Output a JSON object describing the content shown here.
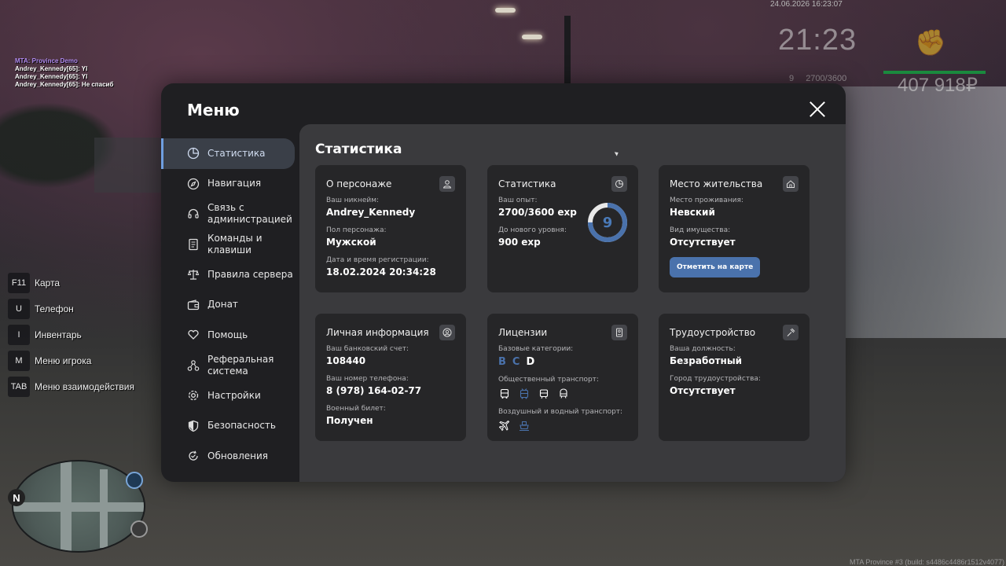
{
  "chat": {
    "server": "MTA: Province Demo",
    "messages": [
      "Andrey_Kennedy[65]: Yl",
      "Andrey_Kennedy[65]: Yl",
      "Andrey_Kennedy[65]: Не спасиб"
    ]
  },
  "hud": {
    "datetime": "24.06.2026 16:23:07",
    "time": "21:23",
    "level": "9",
    "exp": "2700/3600",
    "money": "407 918₽",
    "health_color": "#1a8a3e"
  },
  "hotkeys": [
    {
      "key": "F11",
      "label": "Карта"
    },
    {
      "key": "U",
      "label": "Телефон"
    },
    {
      "key": "I",
      "label": "Инвентарь"
    },
    {
      "key": "M",
      "label": "Меню игрока"
    },
    {
      "key": "TAB",
      "label": "Меню взаимодействия"
    }
  ],
  "minimap": {
    "north": "N"
  },
  "build": "MTA Province #3 (build: s4486c4486r1512v4077)",
  "menu": {
    "title": "Меню",
    "nav": [
      {
        "label": "Статистика",
        "icon": "pie-chart-icon",
        "active": true
      },
      {
        "label": "Навигация",
        "icon": "compass-icon"
      },
      {
        "label": "Связь с администрацией",
        "icon": "headset-icon"
      },
      {
        "label": "Команды и клавиши",
        "icon": "document-icon"
      },
      {
        "label": "Правила сервера",
        "icon": "scales-icon"
      },
      {
        "label": "Донат",
        "icon": "wallet-icon"
      },
      {
        "label": "Помощь",
        "icon": "heart-hand-icon"
      },
      {
        "label": "Реферальная система",
        "icon": "network-icon"
      },
      {
        "label": "Настройки",
        "icon": "gear-icon"
      },
      {
        "label": "Безопасность",
        "icon": "shield-icon"
      },
      {
        "label": "Обновления",
        "icon": "refresh-check-icon"
      }
    ],
    "content_title": "Статистика",
    "cards": {
      "character": {
        "title": "О персонаже",
        "nickname_label": "Ваш никнейм:",
        "nickname": "Andrey_Kennedy",
        "gender_label": "Пол персонажа:",
        "gender": "Мужской",
        "reg_label": "Дата и время регистрации:",
        "reg": "18.02.2024 20:34:28"
      },
      "stats": {
        "title": "Статистика",
        "exp_label": "Ваш опыт:",
        "exp": "2700/3600 exp",
        "next_label": "До нового уровня:",
        "next": "900 exp",
        "level": "9",
        "progress": 0.75,
        "accent": "#4a72ac"
      },
      "residence": {
        "title": "Место жительства",
        "place_label": "Место проживания:",
        "place": "Невский",
        "property_label": "Вид имущества:",
        "property": "Отсутствует",
        "button": "Отметить на карте"
      },
      "personal": {
        "title": "Личная информация",
        "bank_label": "Ваш банковский счет:",
        "bank": "108440",
        "phone_label": "Ваш номер телефона:",
        "phone": "8 (978) 164-02-77",
        "military_label": "Военный билет:",
        "military": "Получен"
      },
      "licenses": {
        "title": "Лицензии",
        "base_label": "Базовые категории:",
        "categories": [
          "B",
          "C",
          "D"
        ],
        "public_label": "Общественный транспорт:",
        "air_label": "Воздушный и водный транспорт:"
      },
      "employment": {
        "title": "Трудоустройство",
        "position_label": "Ваша должность:",
        "position": "Безработный",
        "city_label": "Город трудоустройства:",
        "city": "Отсутствует"
      }
    }
  }
}
